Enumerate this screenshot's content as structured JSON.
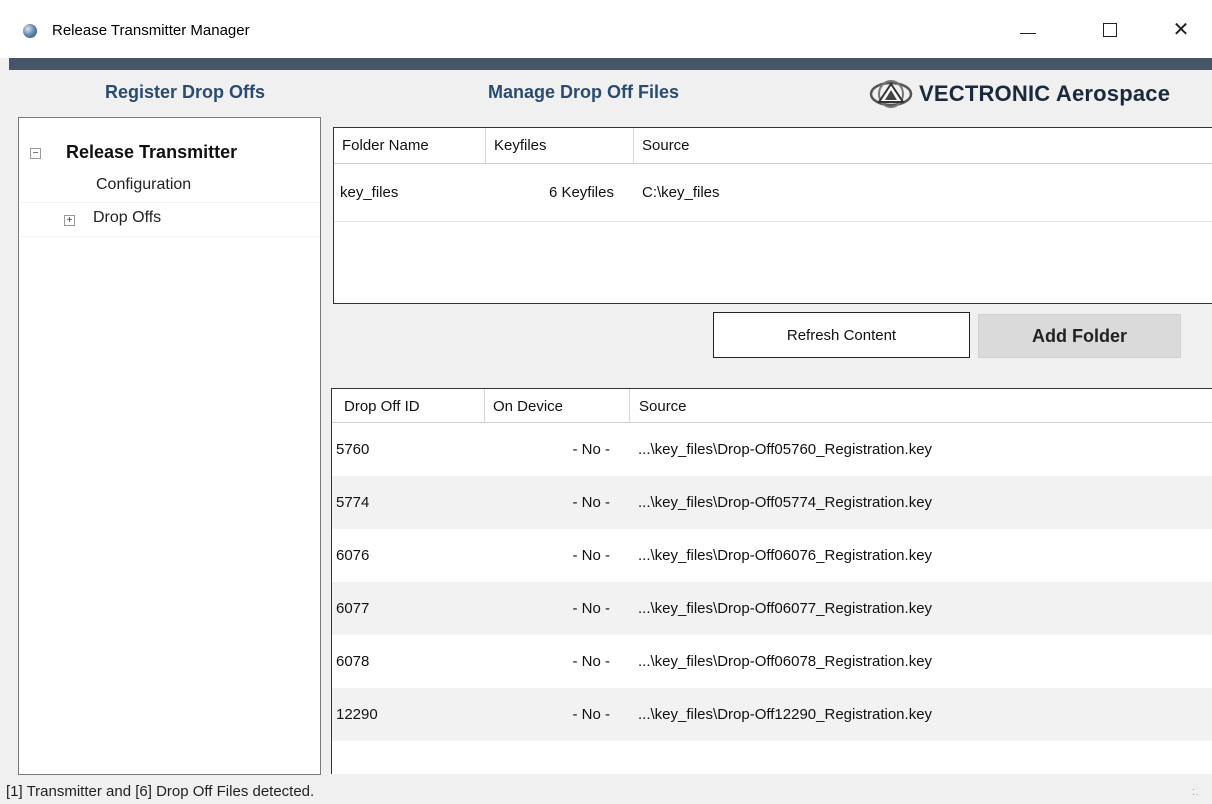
{
  "window": {
    "title": "Release Transmitter Manager",
    "minimize": "—",
    "maximize": "",
    "close": "✕"
  },
  "tabs": [
    {
      "label": "Register Drop Offs"
    },
    {
      "label": "Manage Drop Off Files"
    }
  ],
  "brand": {
    "text": "VECTRONIC Aerospace"
  },
  "tree": {
    "root": {
      "label": "Release Transmitter",
      "expander": "−"
    },
    "items": [
      {
        "label": "Configuration"
      },
      {
        "label": "Drop Offs",
        "expander": "+"
      }
    ]
  },
  "folders": {
    "columns": [
      "Folder Name",
      "Keyfiles",
      "Source"
    ],
    "rows": [
      {
        "name": "key_files",
        "keyfiles": "6 Keyfiles",
        "source": "C:\\key_files"
      }
    ]
  },
  "buttons": {
    "refresh": "Refresh Content",
    "add_folder": "Add Folder"
  },
  "dropoffs": {
    "columns": [
      "Drop Off ID",
      "On Device",
      "Source"
    ],
    "rows": [
      {
        "id": "5760",
        "on_device": "- No -",
        "source": "...\\key_files\\Drop-Off05760_Registration.key"
      },
      {
        "id": "5774",
        "on_device": "- No -",
        "source": "...\\key_files\\Drop-Off05774_Registration.key"
      },
      {
        "id": "6076",
        "on_device": "- No -",
        "source": "...\\key_files\\Drop-Off06076_Registration.key"
      },
      {
        "id": "6077",
        "on_device": "- No -",
        "source": "...\\key_files\\Drop-Off06077_Registration.key"
      },
      {
        "id": "6078",
        "on_device": "- No -",
        "source": "...\\key_files\\Drop-Off06078_Registration.key"
      },
      {
        "id": "12290",
        "on_device": "- No -",
        "source": "...\\key_files\\Drop-Off12290_Registration.key"
      }
    ]
  },
  "status": {
    "text": "[1] Transmitter and [6] Drop Off Files detected."
  },
  "colors": {
    "accent_bar": "#45566b",
    "tab_text": "#2a4b70",
    "alt_row": "#f2f2f2"
  }
}
